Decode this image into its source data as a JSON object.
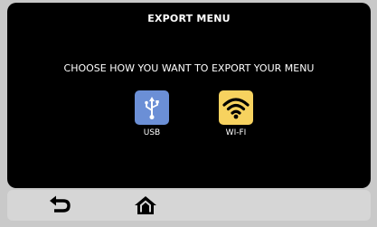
{
  "screen": {
    "title": "EXPORT MENU",
    "subtitle": "CHOOSE HOW YOU WANT TO EXPORT YOUR MENU"
  },
  "options": [
    {
      "label": "USB",
      "icon": "usb-icon",
      "color": "#6b8fd6"
    },
    {
      "label": "WI-FI",
      "icon": "wifi-icon",
      "color": "#f7d25f"
    }
  ],
  "navbar": {
    "back_icon": "back-arrow-icon",
    "home_icon": "home-icon"
  },
  "colors": {
    "screen_background": "#000000",
    "bezel": "#c9c9c9",
    "navbar": "#d6d6d6"
  }
}
